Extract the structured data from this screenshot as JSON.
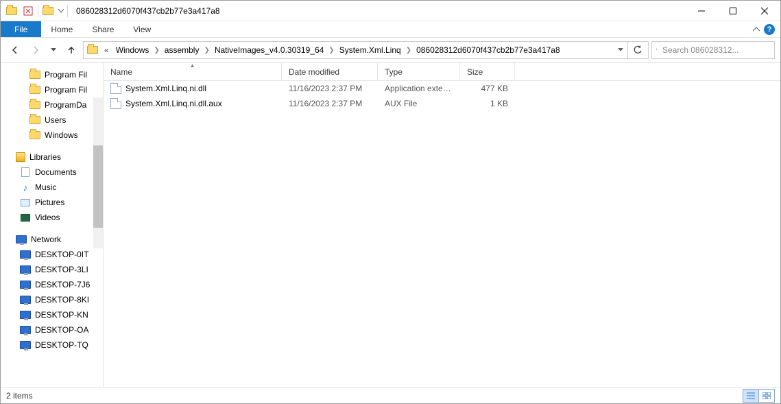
{
  "title": "086028312d6070f437cb2b77e3a417a8",
  "ribbon": {
    "file": "File",
    "tabs": [
      "Home",
      "Share",
      "View"
    ]
  },
  "breadcrumbs": [
    "Windows",
    "assembly",
    "NativeImages_v4.0.30319_64",
    "System.Xml.Linq",
    "086028312d6070f437cb2b77e3a417a8"
  ],
  "search_placeholder": "Search 086028312...",
  "columns": {
    "name": "Name",
    "date": "Date modified",
    "type": "Type",
    "size": "Size"
  },
  "files": [
    {
      "name": "System.Xml.Linq.ni.dll",
      "date": "11/16/2023 2:37 PM",
      "type": "Application exten...",
      "size": "477 KB"
    },
    {
      "name": "System.Xml.Linq.ni.dll.aux",
      "date": "11/16/2023 2:37 PM",
      "type": "AUX File",
      "size": "1 KB"
    }
  ],
  "tree": {
    "top": [
      "Program Fil",
      "Program Fil",
      "ProgramDa",
      "Users",
      "Windows"
    ],
    "libraries_label": "Libraries",
    "libraries": [
      "Documents",
      "Music",
      "Pictures",
      "Videos"
    ],
    "network_label": "Network",
    "network": [
      "DESKTOP-0IT",
      "DESKTOP-3LI",
      "DESKTOP-7J6",
      "DESKTOP-8KI",
      "DESKTOP-KN",
      "DESKTOP-OA",
      "DESKTOP-TQ"
    ]
  },
  "status": "2 items"
}
